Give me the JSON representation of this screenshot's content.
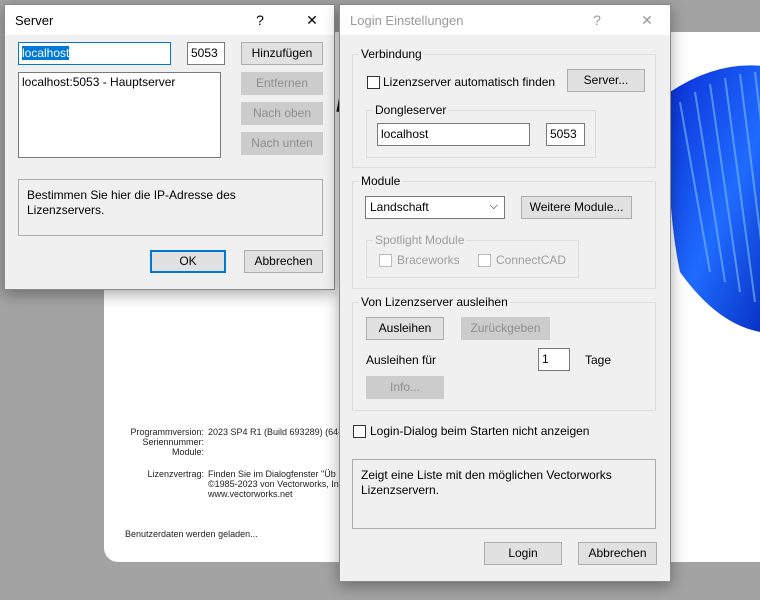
{
  "splash": {
    "info_labels": [
      "Programmversion:",
      "Seriennummer:",
      "Module:",
      "Lizenzvertrag:"
    ],
    "program_version": "2023 SP4 R1 (Build 693289) (64-",
    "license_lines": [
      "Finden Sie im Dialogfenster \"Üb",
      "©1985-2023 von Vectorworks, In",
      "www.vectorworks.net"
    ],
    "status": "Benutzerdaten werden geladen..."
  },
  "server_dialog": {
    "title": "Server",
    "help": "?",
    "close": "✕",
    "host_value": "localhost",
    "port_value": "5053",
    "add": "Hinzufügen",
    "remove": "Entfernen",
    "up": "Nach oben",
    "down": "Nach unten",
    "list_items": [
      "localhost:5053 - Hauptserver"
    ],
    "hint": "Bestimmen Sie hier die IP-Adresse des Lizenzservers.",
    "ok": "OK",
    "cancel": "Abbrechen"
  },
  "login_dialog": {
    "title": "Login Einstellungen",
    "help": "?",
    "close": "✕",
    "connection": {
      "label": "Verbindung",
      "auto_find": "Lizenzserver automatisch finden",
      "server_button": "Server...",
      "dongle_label": "Dongleserver",
      "dongle_host": "localhost",
      "dongle_port": "5053"
    },
    "modules": {
      "label": "Module",
      "selected": "Landschaft",
      "more_button": "Weitere Module...",
      "spotlight_label": "Spotlight Module",
      "braceworks": "Braceworks",
      "connectcad": "ConnectCAD"
    },
    "borrow": {
      "label": "Von Lizenzserver ausleihen",
      "borrow_button": "Ausleihen",
      "return_button": "Zurückgeben",
      "borrow_for": "Ausleihen für",
      "days_value": "1",
      "days_unit": "Tage",
      "info_button": "Info..."
    },
    "no_show": "Login-Dialog beim Starten nicht anzeigen",
    "description": "Zeigt eine Liste mit den möglichen Vectorworks Lizenzservern.",
    "login": "Login",
    "cancel": "Abbrechen"
  }
}
